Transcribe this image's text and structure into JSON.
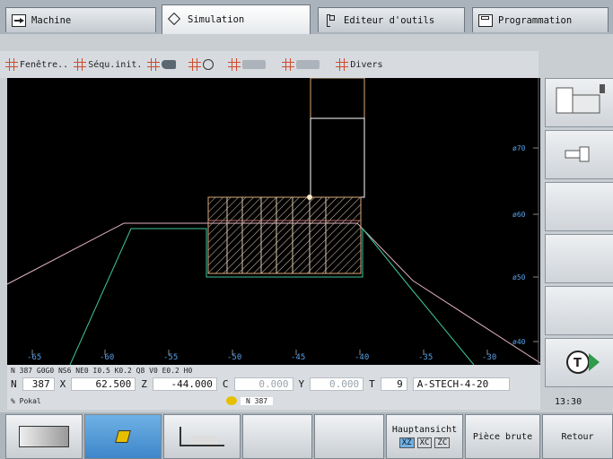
{
  "tabs": {
    "machine": "Machine",
    "simulation": "Simulation",
    "tool_editor": "Editeur d'outils",
    "programming": "Programmation"
  },
  "toolbar": {
    "window": "Fenêtre..",
    "start_sequence": "Séqu.init.",
    "misc": "Divers"
  },
  "graph": {
    "x_ticks": [
      "-65",
      "-60",
      "-55",
      "-50",
      "-45",
      "-40",
      "-35",
      "-30"
    ],
    "y_ticks": [
      "ø70",
      "ø60",
      "ø50",
      "ø40"
    ]
  },
  "status": {
    "block_line": "N 387   G0G0 NS6 NE0 I0.5 K0.2 Q8 V0 E0.2 H0",
    "n_label": "N",
    "n_value": "387",
    "x_label": "X",
    "x_value": "62.500",
    "z_label": "Z",
    "z_value": "-44.000",
    "c_label": "C",
    "c_value": "0.000",
    "y_label": "Y",
    "y_value": "0.000",
    "t_label": "T",
    "t_value": "9",
    "tool_name": "A-STECH-4-20",
    "percent": "% Pokal",
    "mini_n": "N   387"
  },
  "side": {
    "time": "13:30"
  },
  "softkeys": {
    "main_view": "Hauptansicht",
    "view_xz": "XZ",
    "view_xc": "XC",
    "view_zc": "ZC",
    "blank_part": "Pièce brute",
    "back": "Retour"
  }
}
